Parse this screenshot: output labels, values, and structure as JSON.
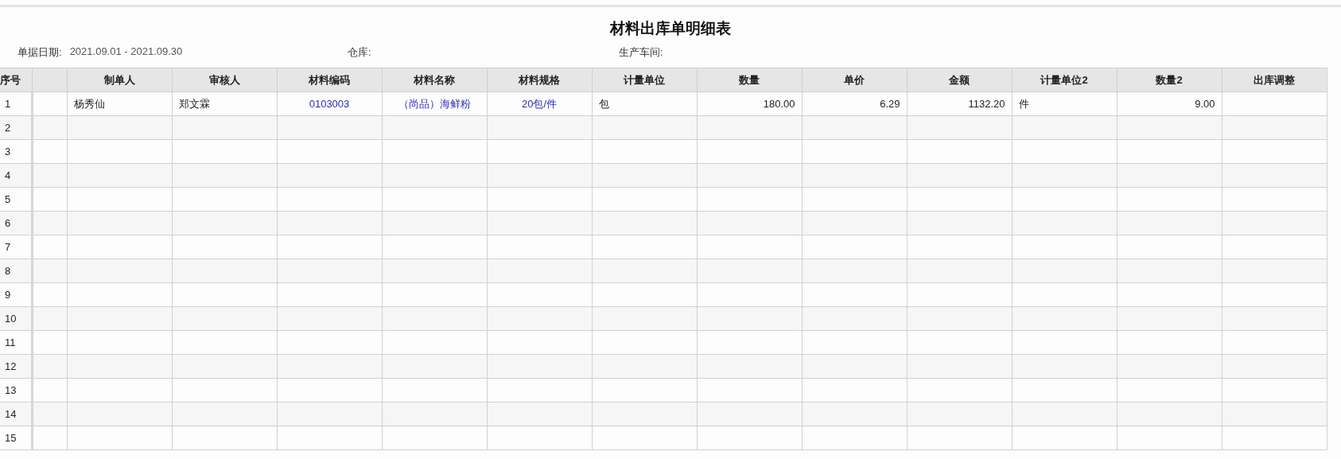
{
  "report": {
    "title": "材料出库单明细表",
    "filters": [
      {
        "label": "单据日期:",
        "value": "2021.09.01 - 2021.09.30"
      },
      {
        "label": "仓库:"
      },
      {
        "label": "生产车间:"
      }
    ]
  },
  "table": {
    "columns": [
      {
        "label": "制单人",
        "kind": "text"
      },
      {
        "label": "审核人",
        "kind": "text"
      },
      {
        "label": "材料编码",
        "kind": "link"
      },
      {
        "label": "材料名称",
        "kind": "link"
      },
      {
        "label": "材料规格",
        "kind": "link"
      },
      {
        "label": "计量单位",
        "kind": "text"
      },
      {
        "label": "数量",
        "kind": "number"
      },
      {
        "label": "单价",
        "kind": "number"
      },
      {
        "label": "金额",
        "kind": "number"
      },
      {
        "label": "计量单位2",
        "kind": "text"
      },
      {
        "label": "数量2",
        "kind": "number"
      },
      {
        "label": "出库调整",
        "kind": "text"
      }
    ],
    "index_label": "序号",
    "rows": [
      {
        "no": "1",
        "cells": [
          "杨秀仙",
          "郑文霖",
          "0103003",
          "（尚品）海鲜粉",
          "20包/件",
          "包",
          "180.00",
          "6.29",
          "1132.20",
          "件",
          "9.00",
          ""
        ]
      },
      {
        "no": "2"
      },
      {
        "no": "3"
      },
      {
        "no": "4"
      },
      {
        "no": "5"
      },
      {
        "no": "6"
      },
      {
        "no": "7"
      },
      {
        "no": "8"
      },
      {
        "no": "9"
      },
      {
        "no": "10"
      },
      {
        "no": "11"
      },
      {
        "no": "12"
      },
      {
        "no": "13"
      },
      {
        "no": "14"
      },
      {
        "no": "15"
      }
    ]
  }
}
